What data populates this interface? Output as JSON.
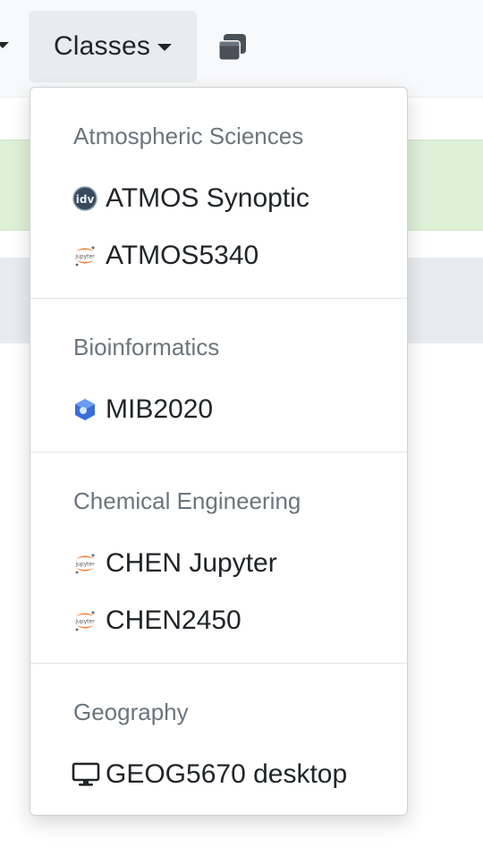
{
  "navbar": {
    "classes_label": "Classes",
    "windows_button": "windows-icon"
  },
  "dropdown": {
    "sections": [
      {
        "header": "Atmospheric Sciences",
        "items": [
          {
            "label": "ATMOS Synoptic",
            "icon": "idv-icon"
          },
          {
            "label": "ATMOS5340",
            "icon": "jupyter-icon"
          }
        ]
      },
      {
        "header": "Bioinformatics",
        "items": [
          {
            "label": "MIB2020",
            "icon": "hexagon-app-icon"
          }
        ]
      },
      {
        "header": "Chemical Engineering",
        "items": [
          {
            "label": "CHEN Jupyter",
            "icon": "jupyter-icon"
          },
          {
            "label": "CHEN2450",
            "icon": "jupyter-icon"
          }
        ]
      },
      {
        "header": "Geography",
        "items": [
          {
            "label": "GEOG5670 desktop",
            "icon": "desktop-icon"
          }
        ]
      }
    ]
  },
  "colors": {
    "header_text": "#6c757d",
    "item_text": "#212529",
    "toggle_bg": "#e9ecef",
    "alert_bg": "#dff0d8",
    "jupyter_orange": "#f37726"
  }
}
